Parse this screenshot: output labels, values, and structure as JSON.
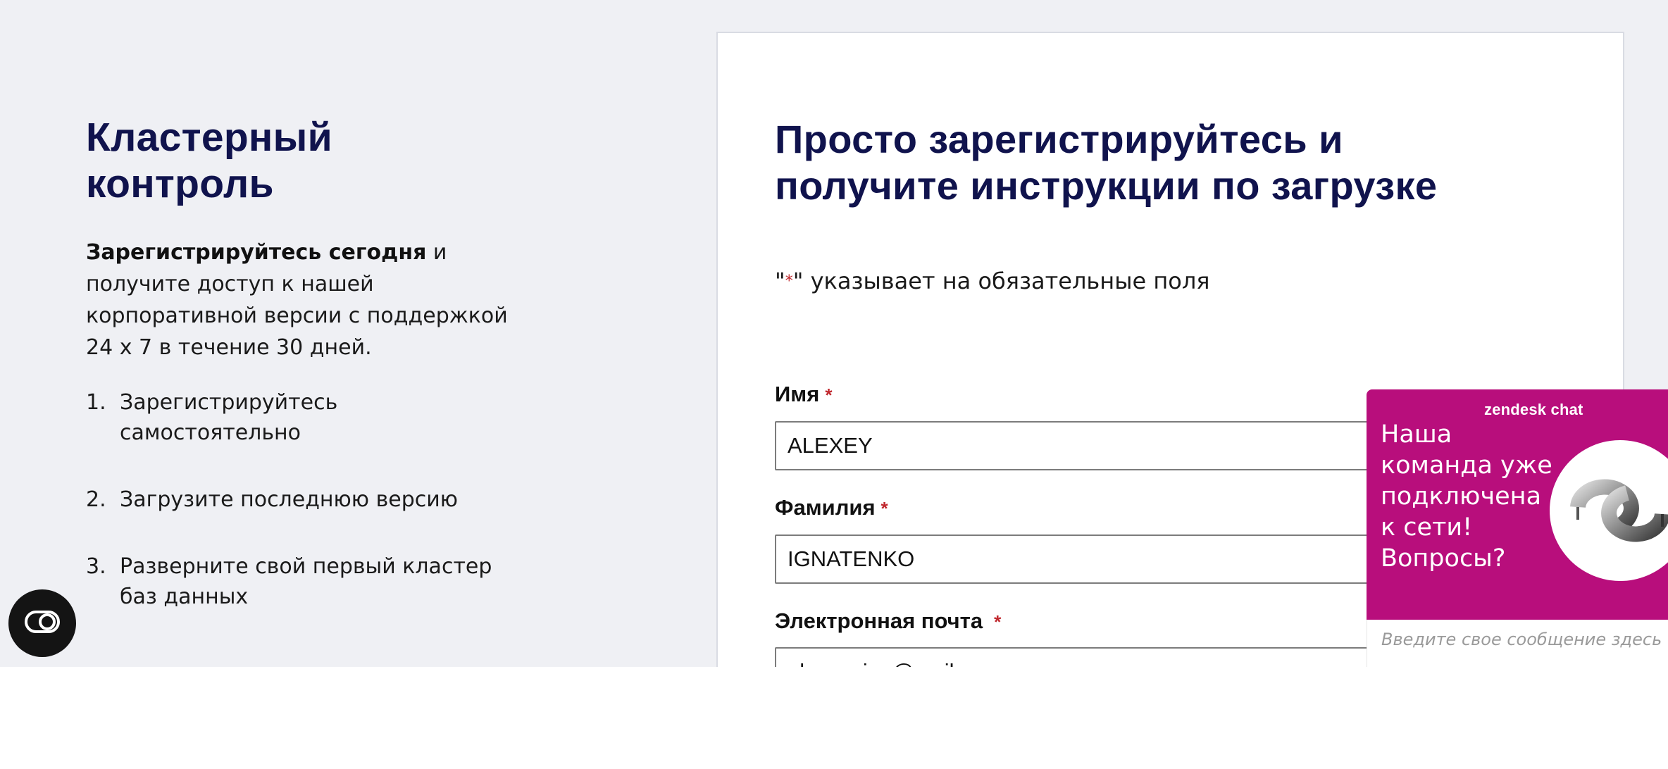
{
  "promo": {
    "title_line1": "Кластерный",
    "title_line2": "контроль",
    "text_bold": "Зарегистрируйтесь сегодня",
    "text_rest": " и получите доступ к нашей корпоративной версии с поддержкой 24 x 7 в течение 30 дней.",
    "steps": [
      {
        "num": "1.",
        "text": "Зарегистрируйтесь самостоятельно"
      },
      {
        "num": "2.",
        "text": "Загрузите последнюю версию"
      },
      {
        "num": "3.",
        "text": "Разверните свой первый кластер баз данных"
      }
    ]
  },
  "form": {
    "title_line1": "Просто зарегистрируйтесь и",
    "title_line2": "получите инструкции по загрузке",
    "required_note_open": "\"",
    "required_note_star": "*",
    "required_note_close": "\" указывает на обязательные поля",
    "required_marker": "*",
    "fields": {
      "first_name": {
        "label": "Имя",
        "value": "ALEXEY"
      },
      "last_name": {
        "label": "Фамилия",
        "value": "IGNATENKO"
      },
      "email": {
        "label": "Электронная почта",
        "value": "alexey_igo@mail.ru"
      }
    }
  },
  "chat": {
    "brand": "zendesk chat",
    "message": "Наша команда уже подключена к сети! Вопросы?",
    "input_placeholder": "Введите свое сообщение здесь",
    "accent_color": "#b80e7c"
  },
  "icons": {
    "a11y": "accessibility-toggle-icon",
    "chat_avatar": "zendesk-logo-icon"
  }
}
